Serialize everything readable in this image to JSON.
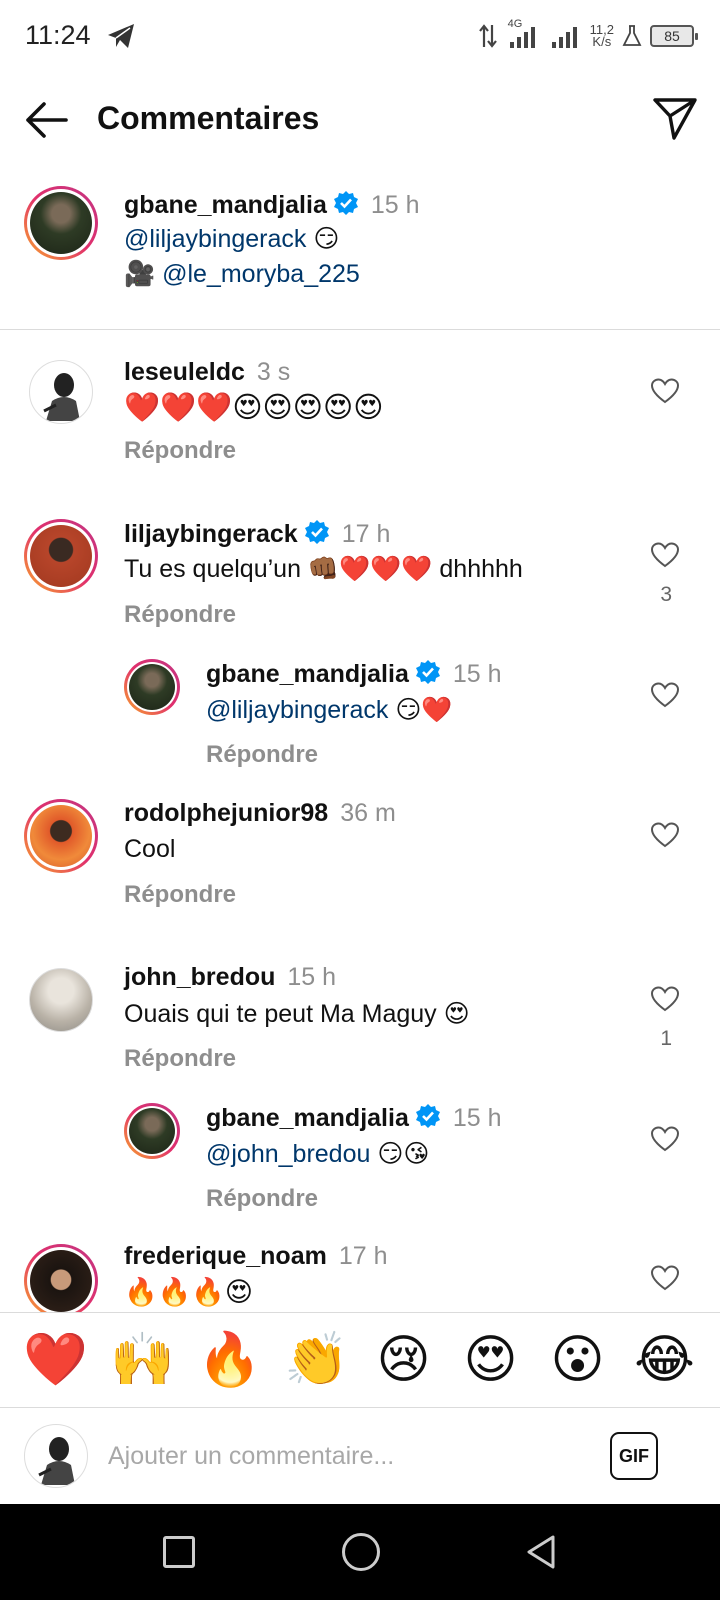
{
  "status_bar": {
    "time": "11:24",
    "network": "4G",
    "speed_value": "11,2",
    "speed_unit": "K/s",
    "battery": "85"
  },
  "header": {
    "title": "Commentaires"
  },
  "caption": {
    "username": "gbane_mandjalia",
    "time": "15 h",
    "line1_mention": "@liljaybingerack",
    "line1_emoji": "😏",
    "line2_emoji": "🎥",
    "line2_mention": "@le_moryba_225"
  },
  "comments": [
    {
      "username": "leseuleldc",
      "verified": false,
      "time": "3 s",
      "text": "❤️❤️❤️😍😍😍😍😍",
      "reply_label": "Répondre",
      "likes": ""
    },
    {
      "username": "liljaybingerack",
      "verified": true,
      "time": "17 h",
      "text": "Tu es quelqu’un 👊🏾❤️❤️❤️ dhhhhh",
      "reply_label": "Répondre",
      "likes": "3"
    },
    {
      "username": "gbane_mandjalia",
      "verified": true,
      "time": "15 h",
      "mention": "@liljaybingerack",
      "text_after": " 😏❤️",
      "reply_label": "Répondre",
      "is_reply": true
    },
    {
      "username": "rodolphejunior98",
      "verified": false,
      "time": "36 m",
      "text": "Cool",
      "reply_label": "Répondre",
      "likes": ""
    },
    {
      "username": "john_bredou",
      "verified": false,
      "time": "15 h",
      "text": "Ouais qui te peut Ma Maguy 😍",
      "reply_label": "Répondre",
      "likes": "1"
    },
    {
      "username": "gbane_mandjalia",
      "verified": true,
      "time": "15 h",
      "mention": "@john_bredou",
      "text_after": " 😏😘",
      "reply_label": "Répondre",
      "is_reply": true
    },
    {
      "username": "frederique_noam",
      "verified": false,
      "time": "17 h",
      "text": "🔥🔥🔥😍"
    }
  ],
  "emoji_bar": [
    "❤️",
    "🙌",
    "🔥",
    "👏",
    "😢",
    "😍",
    "😮",
    "😂"
  ],
  "input": {
    "placeholder": "Ajouter un commentaire...",
    "gif_label": "GIF"
  },
  "colors": {
    "mention": "#00376b",
    "muted": "#8e8e8e",
    "verified": "#0095f6"
  }
}
